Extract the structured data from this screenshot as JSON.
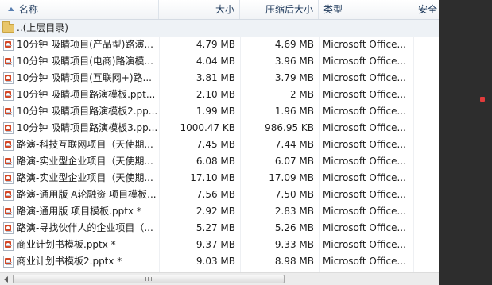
{
  "columns": {
    "name": "名称",
    "size": "大小",
    "compressed": "压缩后大小",
    "type": "类型",
    "security": "安全"
  },
  "parent_row": {
    "label": "..(上层目录)"
  },
  "files": [
    {
      "name": "10分钟 吸睛项目(产品型)路演...",
      "size": "4.79 MB",
      "compressed": "4.69 MB",
      "type": "Microsoft Office..."
    },
    {
      "name": "10分钟 吸睛项目(电商)路演模...",
      "size": "4.04 MB",
      "compressed": "3.96 MB",
      "type": "Microsoft Office..."
    },
    {
      "name": "10分钟 吸睛项目(互联网+)路...",
      "size": "3.81 MB",
      "compressed": "3.79 MB",
      "type": "Microsoft Office..."
    },
    {
      "name": "10分钟 吸睛项目路演模板.ppt...",
      "size": "2.10 MB",
      "compressed": "2 MB",
      "type": "Microsoft Office..."
    },
    {
      "name": "10分钟 吸睛项目路演模板2.pp...",
      "size": "1.99 MB",
      "compressed": "1.96 MB",
      "type": "Microsoft Office..."
    },
    {
      "name": "10分钟 吸睛项目路演模板3.pp...",
      "size": "1000.47 KB",
      "compressed": "986.95 KB",
      "type": "Microsoft Office..."
    },
    {
      "name": "路演-科技互联网项目（天使期...",
      "size": "7.45 MB",
      "compressed": "7.44 MB",
      "type": "Microsoft Office..."
    },
    {
      "name": "路演-实业型企业项目（天使期...",
      "size": "6.08 MB",
      "compressed": "6.07 MB",
      "type": "Microsoft Office..."
    },
    {
      "name": "路演-实业型企业项目（天使期...",
      "size": "17.10 MB",
      "compressed": "17.09 MB",
      "type": "Microsoft Office..."
    },
    {
      "name": "路演-通用版 A轮融资 项目模板...",
      "size": "7.56 MB",
      "compressed": "7.50 MB",
      "type": "Microsoft Office..."
    },
    {
      "name": "路演-通用版 项目模板.pptx *",
      "size": "2.92 MB",
      "compressed": "2.83 MB",
      "type": "Microsoft Office..."
    },
    {
      "name": "路演-寻找伙伴人的企业项目（...",
      "size": "5.27 MB",
      "compressed": "5.26 MB",
      "type": "Microsoft Office..."
    },
    {
      "name": "商业计划书模板.pptx *",
      "size": "9.37 MB",
      "compressed": "9.33 MB",
      "type": "Microsoft Office..."
    },
    {
      "name": "商业计划书模板2.pptx *",
      "size": "9.03 MB",
      "compressed": "8.98 MB",
      "type": "Microsoft Office..."
    }
  ],
  "icons": {
    "sort": "sort-ascending-icon",
    "folder": "folder-up-icon",
    "file": "powerpoint-file-icon"
  },
  "colors": {
    "header_text": "#1e395b",
    "parent_row_bg": "#eef2f6",
    "ppt_red": "#d24726",
    "side_panel": "#2d2d2d"
  }
}
